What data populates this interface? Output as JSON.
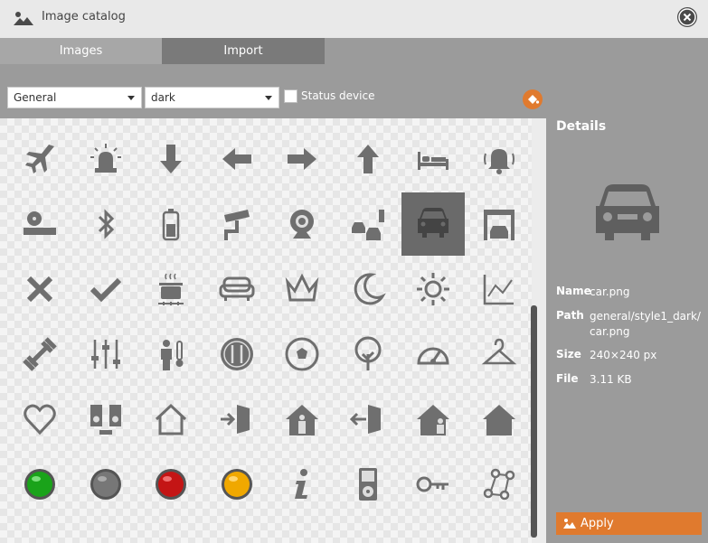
{
  "window": {
    "title": "Image catalog"
  },
  "tabs": [
    {
      "label": "Images",
      "active": true
    },
    {
      "label": "Import",
      "active": false
    }
  ],
  "filters": {
    "category": "General",
    "style": "dark",
    "status_device_label": "Status device",
    "status_device_checked": false
  },
  "icons": [
    [
      "airplane-icon",
      "siren-icon",
      "arrow-down-icon",
      "arrow-left-icon",
      "arrow-right-icon",
      "arrow-up-icon",
      "bed-icon",
      "bell-icon"
    ],
    [
      "dvd-player-icon",
      "bluetooth-icon",
      "battery-icon",
      "security-camera-icon",
      "webcam-icon",
      "traffic-light-cars-icon",
      "car-icon",
      "garage-icon"
    ],
    [
      "cross-icon",
      "check-icon",
      "cooking-pot-icon",
      "sofa-icon",
      "crown-icon",
      "moon-icon",
      "sun-icon",
      "chart-line-icon"
    ],
    [
      "dumbbell-icon",
      "equalizer-icon",
      "person-temperature-icon",
      "restaurant-icon",
      "soccer-ball-icon",
      "tree-icon",
      "gauge-icon",
      "hanger-icon"
    ],
    [
      "heart-icon",
      "speakers-icon",
      "house-outline-icon",
      "door-enter-icon",
      "house-person-icon",
      "door-exit-icon",
      "house-person-alt-icon",
      "house-filled-icon"
    ],
    [
      "green-light-icon",
      "grey-light-icon",
      "red-light-icon",
      "yellow-light-icon",
      "info-icon",
      "ipod-icon",
      "key-icon",
      "network-icon"
    ]
  ],
  "selected_icon": "car-icon",
  "details": {
    "title": "Details",
    "name_label": "Name",
    "name": "car.png",
    "path_label": "Path",
    "path": "general/style1_dark/car.png",
    "size_label": "Size",
    "size": "240×240 px",
    "file_label": "File",
    "file": "3.11 KB"
  },
  "apply_label": "Apply",
  "colors": {
    "accent": "#e07a2e",
    "icon": "#6f6f6f",
    "panel": "#9b9b9b"
  }
}
